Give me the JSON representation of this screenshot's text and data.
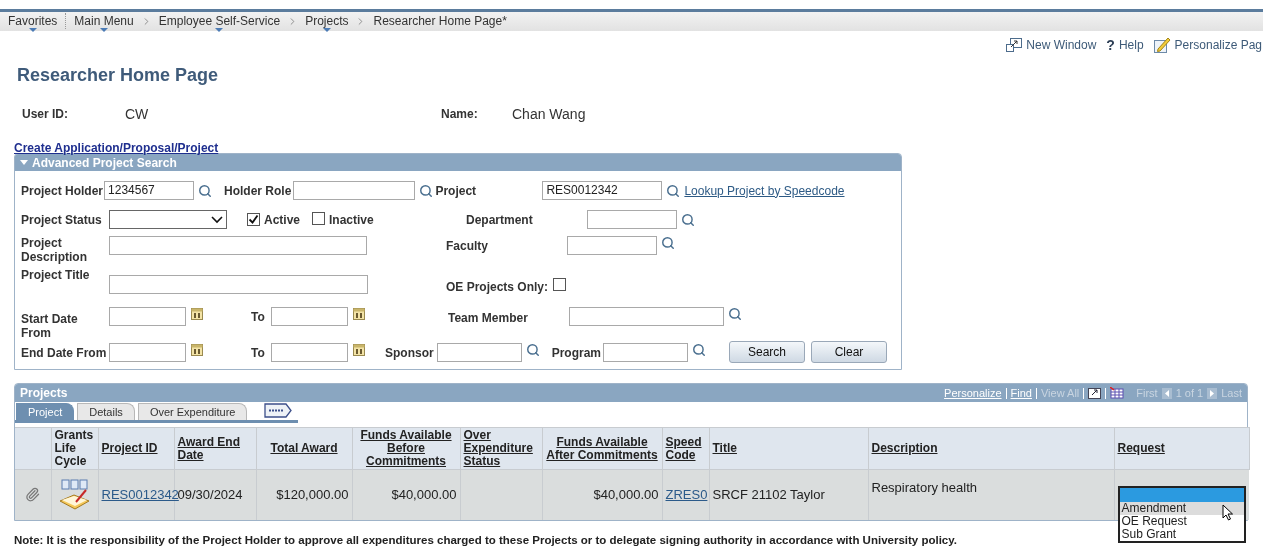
{
  "breadcrumbs": [
    {
      "label": "Favorites",
      "menu": true
    },
    {
      "label": "Main Menu",
      "menu": true
    },
    {
      "label": "Employee Self-Service",
      "menu": true
    },
    {
      "label": "Projects",
      "menu": true
    },
    {
      "label": "Researcher Home Page*",
      "menu": false
    }
  ],
  "header_links": [
    {
      "kind": "new-window",
      "label": "New Window"
    },
    {
      "kind": "help",
      "icon_text": "?",
      "label": "Help"
    },
    {
      "kind": "personalize",
      "label": "Personalize Pag"
    }
  ],
  "page_title": "Researcher Home Page",
  "user": {
    "id_label": "User ID:",
    "id_value": "CW",
    "name_label": "Name:",
    "name_value": "Chan Wang"
  },
  "create_link": "Create Application/Proposal/Project",
  "search": {
    "title": "Advanced Project Search",
    "expanded": true,
    "project_holder": {
      "label": "Project Holder",
      "value": "1234567"
    },
    "holder_role": {
      "label": "Holder Role"
    },
    "project": {
      "label": "Project",
      "value": "RES0012342"
    },
    "speedcode_link": "Lookup Project by Speedcode",
    "project_status": {
      "label": "Project Status"
    },
    "status_checks": [
      {
        "label": "Active",
        "checked": true
      },
      {
        "label": "Inactive",
        "checked": false
      }
    ],
    "department": {
      "label": "Department"
    },
    "description": {
      "label": "Project Description"
    },
    "faculty": {
      "label": "Faculty"
    },
    "title_field": {
      "label": "Project Title"
    },
    "oe_only": {
      "label": "OE Projects Only:",
      "checked": false
    },
    "start_date": {
      "label": "Start Date From",
      "to_label": "To"
    },
    "team_member": {
      "label": "Team Member"
    },
    "end_date": {
      "label": "End Date From",
      "to_label": "To"
    },
    "sponsor": {
      "label": "Sponsor"
    },
    "program": {
      "label": "Program"
    },
    "buttons": [
      "Search",
      "Clear"
    ]
  },
  "projects": {
    "title": "Projects",
    "toolbar": [
      {
        "label": "Personalize",
        "disabled": false
      },
      {
        "label": "Find",
        "disabled": false
      },
      {
        "label": "View All",
        "disabled": true
      }
    ],
    "pager": {
      "first": "First",
      "range": "1 of 1",
      "last": "Last"
    },
    "tabs": [
      {
        "label": "Project",
        "selected": true
      },
      {
        "label": "Details",
        "selected": false
      },
      {
        "label": "Over Expenditure",
        "selected": false
      }
    ],
    "columns": [
      {
        "label": "Grants Life Cycle",
        "link": false
      },
      {
        "label": "Project ID",
        "link": true
      },
      {
        "label": "Award End Date",
        "link": true
      },
      {
        "label": "Total Award",
        "link": true
      },
      {
        "label": "Funds Available Before Commitments",
        "link": true
      },
      {
        "label": "Over Expenditure Status",
        "link": true
      },
      {
        "label": "Funds Available After Commitments",
        "link": true
      },
      {
        "label": "Speed Code",
        "link": true
      },
      {
        "label": "Title",
        "link": true
      },
      {
        "label": "Description",
        "link": true
      },
      {
        "label": "Request",
        "link": true
      }
    ],
    "rows": [
      {
        "project_id": "RES0012342",
        "award_end_date": "09/30/2024",
        "total_award": "$120,000.00",
        "funds_before": "$40,000.00",
        "funds_after": "$40,000.00",
        "speed_code": "ZRES0",
        "title": "SRCF 21102 Taylor",
        "description": "Respiratory health",
        "request": {
          "expanded": true,
          "blank_option_selected": true,
          "options": [
            {
              "label": "Amendment",
              "hovered": true
            },
            {
              "label": "OE Request",
              "hovered": false
            },
            {
              "label": "Sub Grant",
              "hovered": false
            }
          ]
        }
      }
    ]
  },
  "note": "Note: It is the responsibility of the Project Holder to approve all expenditures charged to these Projects or to delegate signing authority in accordance with University policy."
}
